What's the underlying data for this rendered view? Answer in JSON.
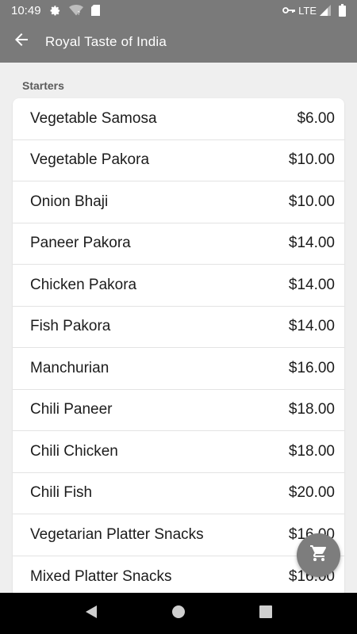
{
  "status_bar": {
    "time": "10:49",
    "network": "LTE",
    "icons": [
      "settings-icon",
      "wifi-question-icon",
      "sd-card-icon",
      "key-icon",
      "signal-icon",
      "battery-icon"
    ]
  },
  "app_bar": {
    "title": "Royal Taste of India",
    "back_icon": "arrow-back-icon"
  },
  "section": {
    "title": "Starters"
  },
  "menu_items": [
    {
      "name": "Vegetable Samosa",
      "price": "$6.00"
    },
    {
      "name": "Vegetable Pakora",
      "price": "$10.00"
    },
    {
      "name": "Onion Bhaji",
      "price": "$10.00"
    },
    {
      "name": "Paneer Pakora",
      "price": "$14.00"
    },
    {
      "name": "Chicken Pakora",
      "price": "$14.00"
    },
    {
      "name": "Fish Pakora",
      "price": "$14.00"
    },
    {
      "name": "Manchurian",
      "price": "$16.00"
    },
    {
      "name": "Chili Paneer",
      "price": "$18.00"
    },
    {
      "name": "Chili Chicken",
      "price": "$18.00"
    },
    {
      "name": "Chili Fish",
      "price": "$20.00"
    },
    {
      "name": "Vegetarian Platter Snacks",
      "price": "$16.00"
    },
    {
      "name": "Mixed Platter Snacks",
      "price": "$16.00"
    }
  ],
  "fab": {
    "icon": "shopping-cart-icon"
  },
  "nav_bar": {
    "icons": [
      "back-triangle-icon",
      "home-circle-icon",
      "recents-square-icon"
    ]
  },
  "colors": {
    "app_bar": "#7a7a7a",
    "background": "#efefef",
    "card": "#ffffff",
    "fab": "#7d7d7d",
    "nav_bar": "#000000"
  }
}
